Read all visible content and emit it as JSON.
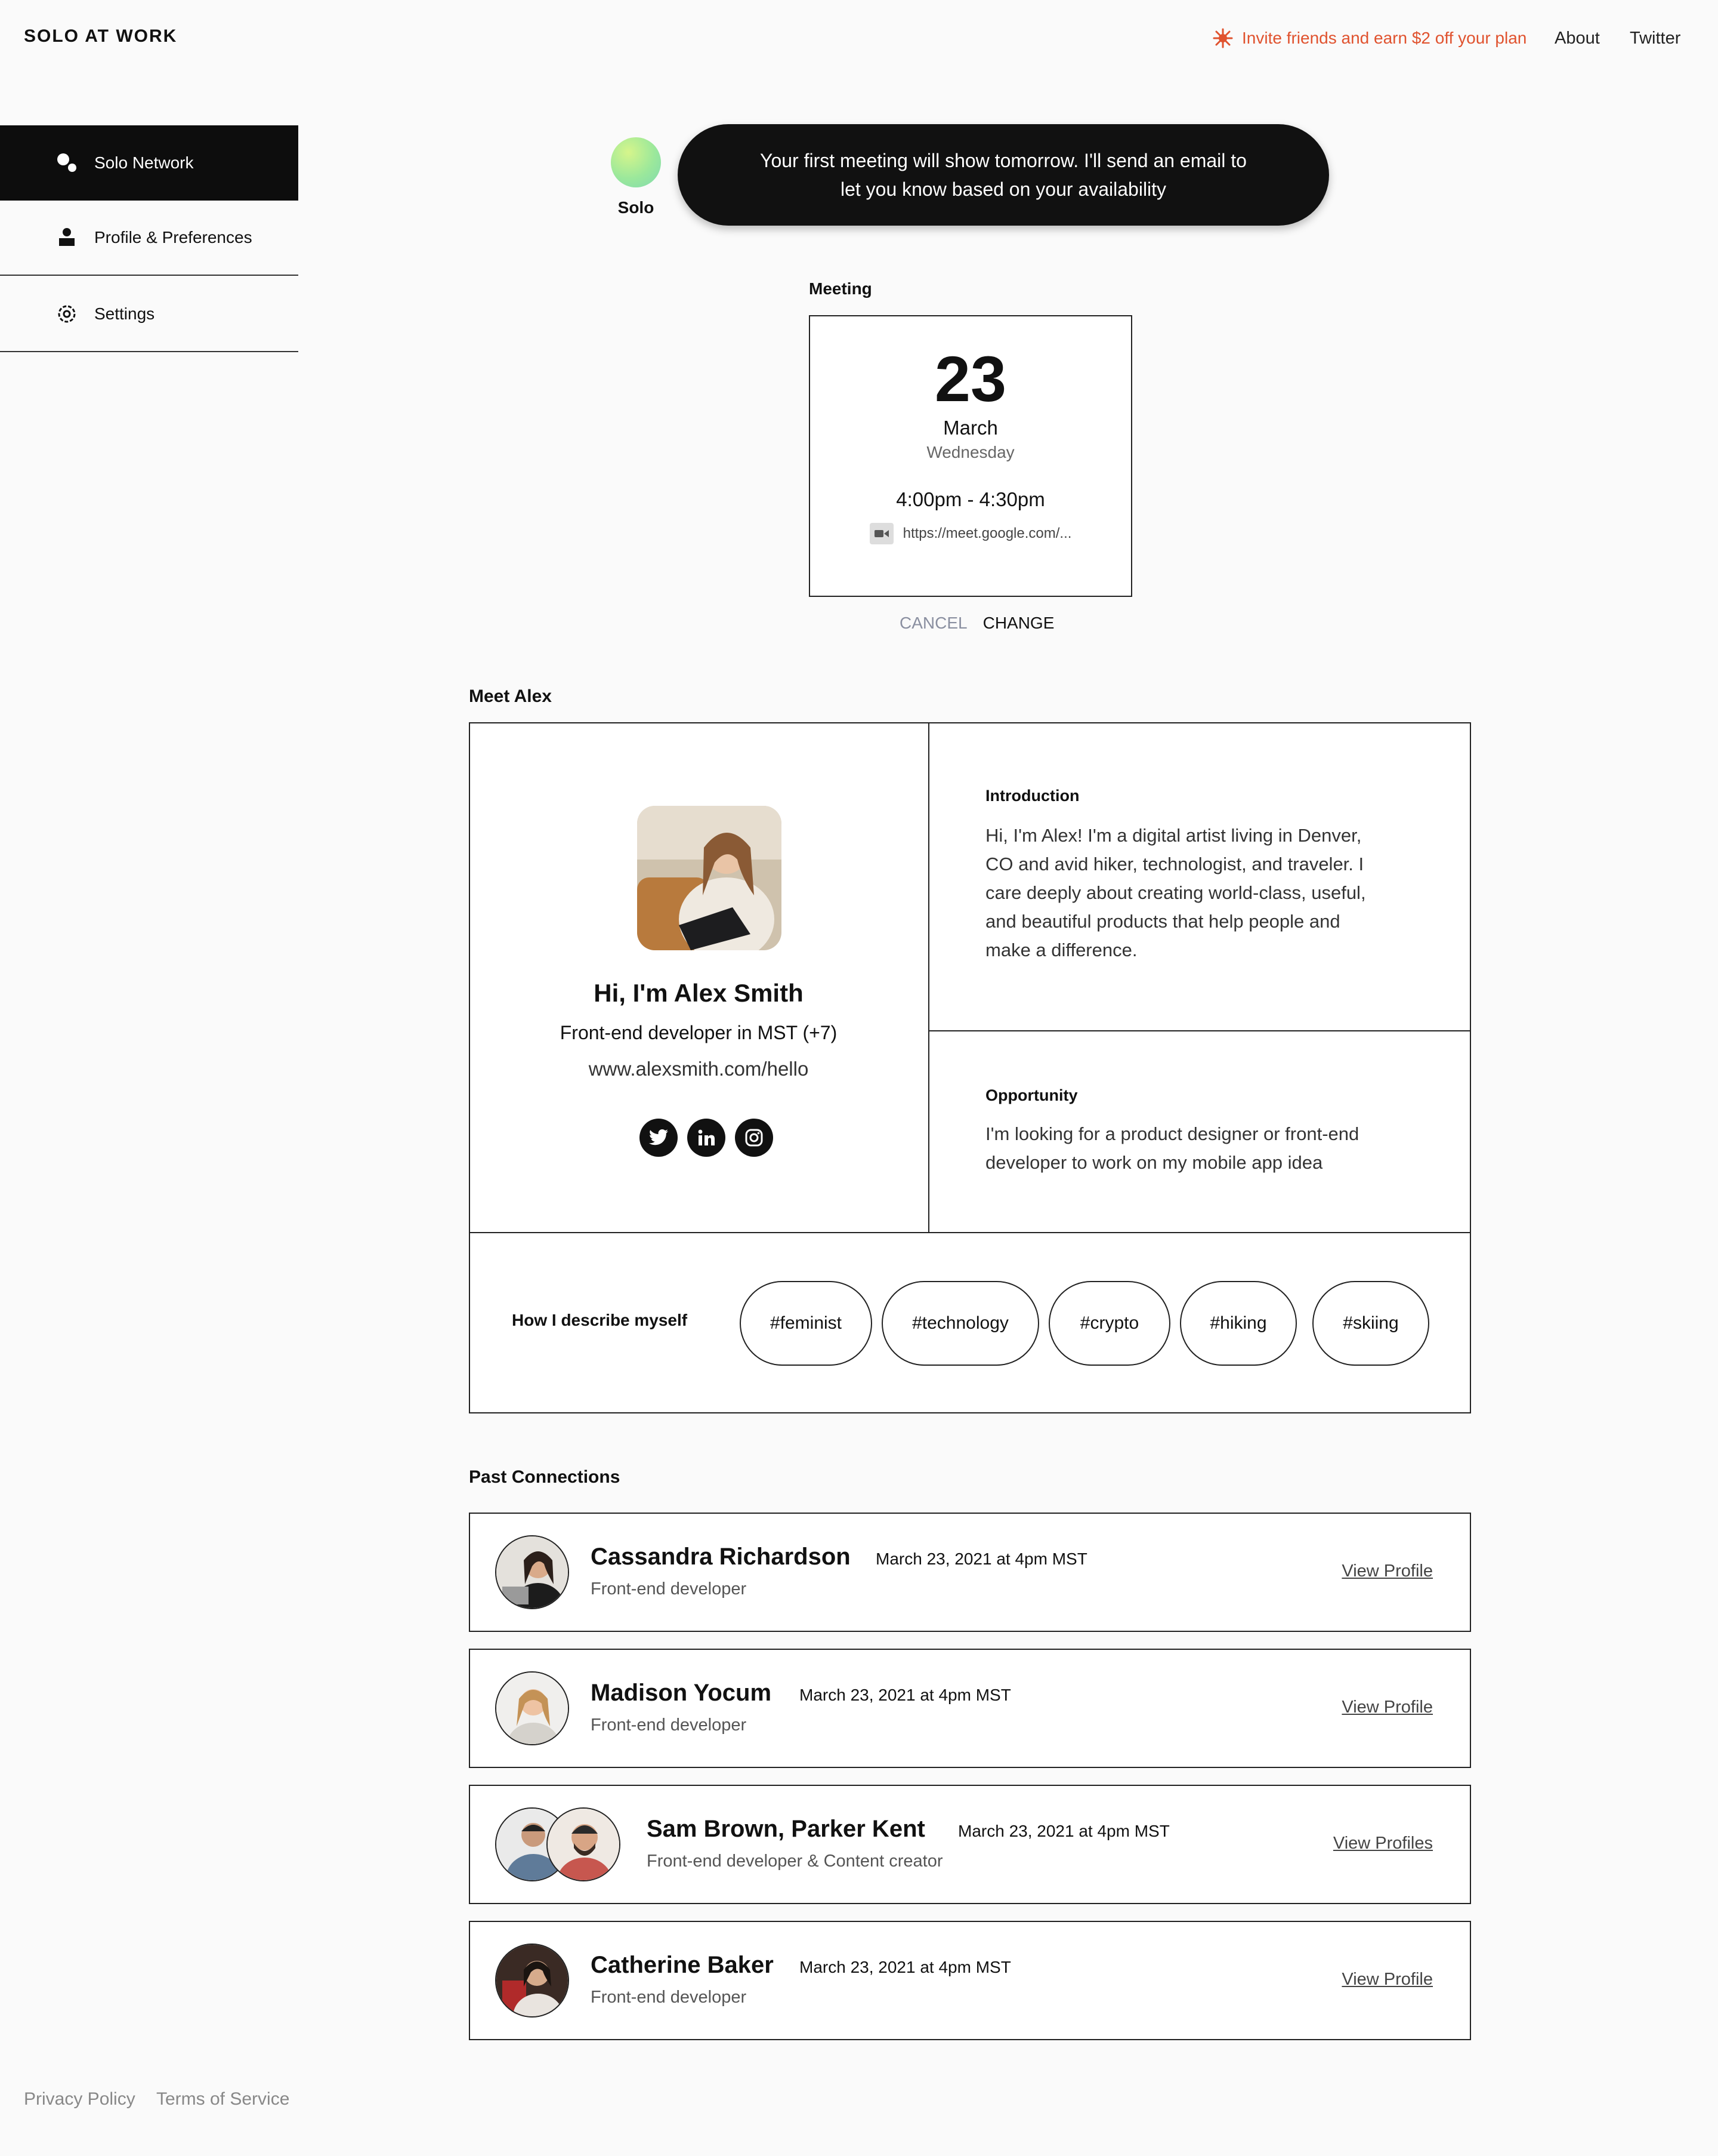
{
  "header": {
    "brand": "SOLO AT WORK",
    "invite_text": "Invite friends and earn $2 off your plan",
    "nav": [
      "About",
      "Twitter"
    ],
    "accent_color": "#e0522e"
  },
  "sidebar": {
    "items": [
      {
        "label": "Solo Network",
        "icon": "network-icon",
        "active": true
      },
      {
        "label": "Profile & Preferences",
        "icon": "user-icon",
        "active": false
      },
      {
        "label": "Settings",
        "icon": "gear-icon",
        "active": false
      }
    ]
  },
  "assistant": {
    "name": "Solo",
    "message": "Your first meeting will show tomorrow. I'll send an email to let you know based on your availability"
  },
  "meeting": {
    "label": "Meeting",
    "day": "23",
    "month": "March",
    "weekday": "Wednesday",
    "time": "4:00pm - 4:30pm",
    "link": "https://meet.google.com/...",
    "cancel_label": "CANCEL",
    "change_label": "CHANGE"
  },
  "profile": {
    "section_title": "Meet Alex",
    "name": "Hi, I'm Alex Smith",
    "role": "Front-end developer",
    "timezone": "in MST (+7)",
    "website": "www.alexsmith.com/hello",
    "socials": [
      "twitter-icon",
      "linkedin-icon",
      "instagram-icon"
    ],
    "introduction_title": "Introduction",
    "introduction_body": "Hi, I'm Alex! I'm a digital artist living in Denver, CO and avid hiker, technologist, and traveler. I care deeply about creating world-class, useful, and beautiful products that help people and make a difference.",
    "opportunity_title": "Opportunity",
    "opportunity_body": "I'm looking for a product designer or front-end developer to work on my mobile app idea",
    "describe_label": "How I describe myself",
    "tags": [
      "#feminist",
      "#technology",
      "#crypto",
      "#hiking",
      "#skiing"
    ]
  },
  "connections": {
    "section_title": "Past Connections",
    "items": [
      {
        "name": "Cassandra Richardson",
        "date": "March 23, 2021 at 4pm MST",
        "role": "Front-end developer",
        "action": "View Profile"
      },
      {
        "name": "Madison Yocum",
        "date": "March 23, 2021 at 4pm MST",
        "role": "Front-end developer",
        "action": "View Profile"
      },
      {
        "name": "Sam Brown, Parker Kent",
        "date": "March 23, 2021 at 4pm MST",
        "role": "Front-end developer & Content creator",
        "action": "View Profiles"
      },
      {
        "name": "Catherine Baker",
        "date": "March 23, 2021 at 4pm MST",
        "role": "Front-end developer",
        "action": "View Profile"
      }
    ]
  },
  "footer": {
    "links": [
      "Privacy Policy",
      "Terms of Service"
    ]
  }
}
